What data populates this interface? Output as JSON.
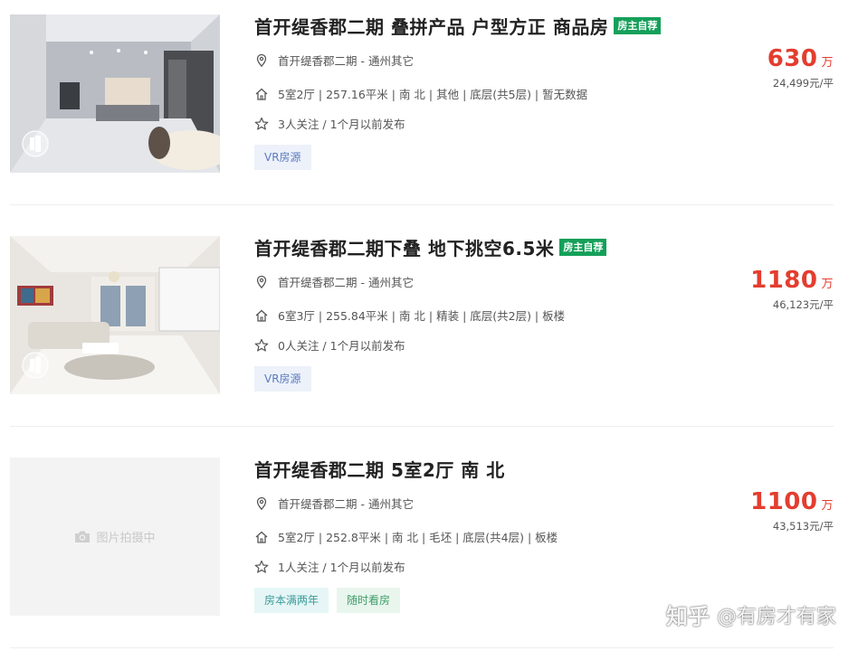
{
  "listings": [
    {
      "title": "首开缇香郡二期 叠拼产品 户型方正 商品房",
      "badge": "房主自荐",
      "community": "首开缇香郡二期 - 通州其它",
      "details": "5室2厅 | 257.16平米 | 南 北 | 其他 | 底层(共5层) | 暂无数据",
      "followers": "3人关注 / 1个月以前发布",
      "tags": [
        "VR房源"
      ],
      "price": "630",
      "price_unit": "万",
      "unit_price": "24,499元/平"
    },
    {
      "title": "首开缇香郡二期下叠 地下挑空6.5米",
      "badge": "房主自荐",
      "community": "首开缇香郡二期 - 通州其它",
      "details": "6室3厅 | 255.84平米 | 南 北 | 精装 | 底层(共2层) | 板楼",
      "followers": "0人关注 / 1个月以前发布",
      "tags": [
        "VR房源"
      ],
      "price": "1180",
      "price_unit": "万",
      "unit_price": "46,123元/平"
    },
    {
      "title": "首开缇香郡二期 5室2厅 南 北",
      "badge": "",
      "community": "首开缇香郡二期 - 通州其它",
      "details": "5室2厅 | 252.8平米 | 南 北 | 毛坯 | 底层(共4层) | 板楼",
      "followers": "1人关注 / 1个月以前发布",
      "tags": [
        "房本满两年",
        "随时看房"
      ],
      "price": "1100",
      "price_unit": "万",
      "unit_price": "43,513元/平",
      "placeholder_text": "图片拍摄中"
    }
  ],
  "watermark": {
    "brand": "知乎",
    "handle": "@有房才有家"
  },
  "icons": {
    "location": "location-pin-icon",
    "house": "house-icon",
    "star": "star-icon",
    "camera": "camera-icon",
    "vr": "vr-panorama-icon"
  },
  "colors": {
    "price": "#e33d2f",
    "owner_badge": "#15a05a",
    "vr_tag_bg": "#edf1f9",
    "vr_tag_text": "#5a7cc0"
  }
}
